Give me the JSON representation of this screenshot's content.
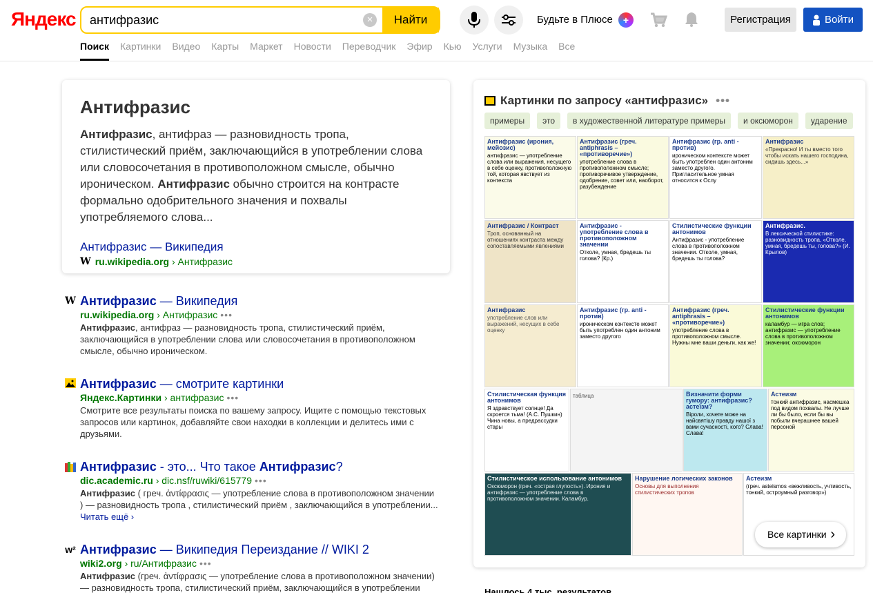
{
  "header": {
    "logo": "Яндекс",
    "search_value": "антифразис",
    "search_button": "Найти",
    "plus_text": "Будьте в Плюсе",
    "register": "Регистрация",
    "login": "Войти",
    "tabs": [
      "Поиск",
      "Картинки",
      "Видео",
      "Карты",
      "Маркет",
      "Новости",
      "Переводчик",
      "Эфир",
      "Кью",
      "Услуги",
      "Музыка",
      "Все"
    ]
  },
  "entity": {
    "title": "Антифразис",
    "text_b1": "Антифразис",
    "text_1": ", антифраз — разновидность тропа, стилистический приём, заключающийся в употреблении слова или словосочетания в противоположном смысле, обычно ироническом. ",
    "text_b2": "Антифразис",
    "text_2": " обычно строится на контрасте формально одобрительного значения и похвалы употребляемого слова...",
    "link": "Антифразис — Википедия",
    "src_domain": "ru.wikipedia.org",
    "src_path": "› Антифразис"
  },
  "results": [
    {
      "icon": "W",
      "title_b": "Антифразис",
      "title_rest": " — Википедия",
      "url_domain": "ru.wikipedia.org",
      "url_path": "› Антифразис",
      "snippet_b": "Антифразис",
      "snippet": ", антифраз — разновидность тропа, стилистический приём, заключающийся в употреблении слова или словосочетания в противоположном смысле, обычно ироническом."
    },
    {
      "icon": "image-icon",
      "title_b": "Антифразис",
      "title_rest": " — смотрите картинки",
      "url_domain": "Яндекс.Картинки",
      "url_path": "› антифразис",
      "snippet": "Смотрите все результаты поиска по вашему запросу. Ищите с помощью текстовых запросов или картинок, добавляйте свои находки в коллекции и делитесь ими с друзьями."
    },
    {
      "icon": "books-icon",
      "title_b": "Антифразис",
      "title_mid": " - это... Что такое ",
      "title_b2": "Антифразис",
      "title_end": "?",
      "url_domain": "dic.academic.ru",
      "url_path": "› dic.nsf/ruwiki/615779",
      "snippet_b": "Антифразис",
      "snippet": " ( греч. ἀντίφρασις — употребление слова в противоположном значении ) — разновидность тропа , стилистический приём , заключающийся в употреблении...",
      "more": "Читать ещё ›"
    },
    {
      "icon": "w²",
      "title_b": "Антифразис",
      "title_rest": " — Википедия Переиздание // WIKI 2",
      "url_domain": "wiki2.org",
      "url_path": "› ru/Антифразис",
      "snippet_b": "Антифразис",
      "snippet": " (греч. ἀντίφρασις — употребление слова в противоположном значении) — разновидность тропа, стилистический приём, заключающийся в употреблении слова"
    }
  ],
  "images": {
    "title": "Картинки по запросу «антифразис»",
    "chips": [
      "примеры",
      "это",
      "в художественной литературе примеры",
      "и оксюморон",
      "ударение"
    ],
    "tiles": [
      {
        "t": "Антифразис (ирония, мейозис)",
        "b": "антифразис — употребление слова или выражения, несущего в себе оценку, противоположную той, которая явствует из контекста",
        "bg": "#fbfbe9",
        "fg": "#000"
      },
      {
        "t": "Антифразис (греч. antiphrasis – «противоречие»)",
        "b": "употребление слова в противоположном смысле; противоречивое утверждение, одобрение, совет или, наоборот, разубеждение",
        "bg": "#fafae0",
        "fg": "#000"
      },
      {
        "t": "Антифразис (гр. anti - против)",
        "b": "ироническом контексте может быть употреблен один антоним заместо другого. Пригласительное умная относится к Ослу",
        "bg": "#ffffff",
        "fg": "#000"
      },
      {
        "t": "Антифразис",
        "b": "«Прекрасно! И ты вместо того чтобы искать нашего господина, сидишь здесь...»",
        "bg": "#f6efc8",
        "fg": "#333"
      },
      {
        "t": "Антифразис / Контраст",
        "b": "Троп, основанный на отношениях контраста между сопоставляемыми явлениями",
        "bg": "#efe4c7",
        "fg": "#333"
      },
      {
        "t": "Антифразис - употребление слова в противоположном значении",
        "b": "Отколе, умная, бредешь ты голова? (Кр.)",
        "bg": "#ffffff",
        "fg": "#000"
      },
      {
        "t": "Стилистические функции антонимов",
        "b": "Антифразис - употребление слова в противоположном значении. Отколе, умная, бредешь ты голова?",
        "bg": "#ffffff",
        "fg": "#000"
      },
      {
        "t": "Антифразис.",
        "b": "В лексической стилистике: разновидность тропа, «Отколе, умная, бредешь ты, голова?» (И. Крылов)",
        "bg": "#1a2ab0",
        "fg": "#fff"
      },
      {
        "t": "Антифразис",
        "b": "употребление слов или выражений, несущих в себе оценку",
        "bg": "#f5ecd0",
        "fg": "#555"
      },
      {
        "t": "Антифразис (гр. anti - против)",
        "b": "ироническом контексте может быть употреблен один антоним заместо другого",
        "bg": "#ffffff",
        "fg": "#000"
      },
      {
        "t": "Антифразис (греч. antiphrasis – «противоречие»)",
        "b": "употребление слова в противоположном смысле. Нужны мне ваши деньги, как же!",
        "bg": "#fafad8",
        "fg": "#000"
      },
      {
        "t": "Стилистические функции антонимов",
        "b": "каламбур — игра слов; антифразис — употребление слова в противоположном значении; оксюморон",
        "bg": "#a8f07a",
        "fg": "#000"
      },
      {
        "t": "Стилистическая функция антонимов",
        "b": "Я здравствует солнце! Да скроется тьма! (А.С. Пушкин) Чина новы, а предрассудки стары",
        "bg": "#ffffff",
        "fg": "#000"
      },
      {
        "t": "",
        "b": "таблица",
        "bg": "#f4f4f4",
        "fg": "#555"
      },
      {
        "t": "Визначити форми гумору: антифразис? астеїзм?",
        "b": "Віроли, хочете може на найсвятішу правду нашої з вами сучасності, кого? Слава! Слава!",
        "bg": "#bde8ef",
        "fg": "#000"
      },
      {
        "t": "Астеизм",
        "b": "тонкий антифразис, насмешка под видом похвалы. Не лучше ли бы было, если бы вы побыли вчерашнее вашей персоной",
        "bg": "#fbfbe4",
        "fg": "#000"
      },
      {
        "t": "Стилистическое использование антонимов",
        "b": "Оксюморон (греч. «острая глупость»). Ирония и антифразис — употребление слова в противоположном значении. Каламбур.",
        "bg": "#1f4d52",
        "fg": "#e8f0f0"
      },
      {
        "t": "Нарушение логических законов",
        "b": "Основы для выполнения стилистических тропов",
        "bg": "#fff7f2",
        "fg": "#9a2a2a"
      },
      {
        "t": "Астеизм",
        "b": "(греч. asteismos «вежливость, учтивость, тонкий, остроумный разговор»)",
        "bg": "#ffffff",
        "fg": "#000"
      }
    ],
    "all_button": "Все картинки"
  },
  "found_text": "Нашлось 4 тыс. результатов"
}
